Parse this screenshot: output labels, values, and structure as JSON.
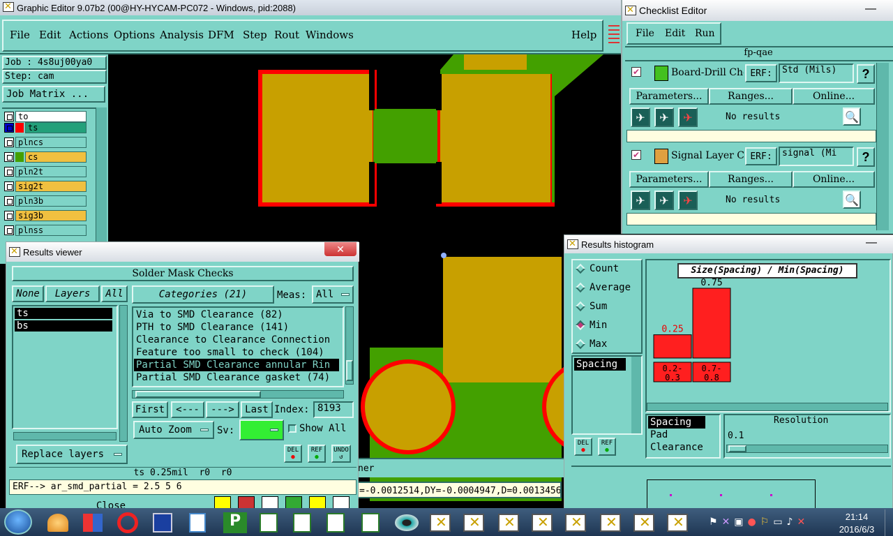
{
  "main_window": {
    "title": "Graphic Editor 9.07b2 (00@HY-HYCAM-PC072 - Windows, pid:2088)",
    "menu": [
      "File",
      "Edit",
      "Actions",
      "Options",
      "Analysis",
      "DFM",
      "Step",
      "Rout",
      "Windows"
    ],
    "help": "Help",
    "job": "Job : 4s8uj00ya0",
    "step": "Step: cam",
    "job_matrix": "Job Matrix ...",
    "layers": [
      {
        "name": "to",
        "color": "#ffffff"
      },
      {
        "name": "ts",
        "color": "#23a07a"
      },
      {
        "name": "plncs",
        "color": "#7fd4c7"
      },
      {
        "name": "cs",
        "color": "#f0c040"
      },
      {
        "name": "pln2t",
        "color": "#7fd4c7"
      },
      {
        "name": "sig2t",
        "color": "#f0c040"
      },
      {
        "name": "pln3b",
        "color": "#7fd4c7"
      },
      {
        "name": "sig3b",
        "color": "#f0c040"
      },
      {
        "name": "plnss",
        "color": "#7fd4c7"
      }
    ],
    "status_text": "ner",
    "coord_readout": "=-0.0012514,DY=-0.0004947,D=0.0013456"
  },
  "results_viewer": {
    "title": "Results viewer",
    "header": "Solder Mask Checks",
    "none_btn": "None",
    "layers_label": "Layers",
    "all_btn": "All",
    "layer_list": [
      "ts",
      "bs"
    ],
    "categories_label": "Categories (21)",
    "meas_label": "Meas:",
    "meas_value": "All",
    "categories": [
      "Via to SMD Clearance (82)",
      "PTH to SMD Clearance (141)",
      "Clearance to Clearance Connection",
      "Feature too small to check (104)",
      "Partial SMD Clearance annular Rin",
      "Partial SMD Clearance gasket (74)"
    ],
    "first": "First",
    "prev": "<---",
    "next": "--->",
    "last": "Last",
    "index_label": "Index:",
    "index_value": "8193",
    "auto_zoom": "Auto Zoom",
    "sv_label": "Sv:",
    "show_all": "Show All",
    "replace_layers": "Replace layers",
    "del": "DEL",
    "ref": "REF",
    "undo": "UNDO",
    "info_line": "ts 0.25mil  r0  r0",
    "erf_line": "ERF--> ar_smd_partial = 2.5 5 6",
    "close": "Close"
  },
  "checklist_editor": {
    "title": "Checklist Editor",
    "menu": [
      "File",
      "Edit",
      "Run"
    ],
    "checklist_name": "fp-qae",
    "items": [
      {
        "name": "Board-Drill Che",
        "erf_label": "ERF:",
        "erf_value": "Std (Mils)",
        "parameters": "Parameters...",
        "ranges": "Ranges...",
        "online": "Online...",
        "result": "No results"
      },
      {
        "name": "Signal Layer Ch",
        "erf_label": "ERF:",
        "erf_value": "signal (Mi",
        "parameters": "Parameters...",
        "ranges": "Ranges...",
        "online": "Online...",
        "result": "No results"
      }
    ],
    "help_glyph": "?"
  },
  "histogram": {
    "title": "Results histogram",
    "modes": [
      "Count",
      "Average",
      "Sum",
      "Min",
      "Max"
    ],
    "selected_mode": "Min",
    "left_list": [
      "Spacing"
    ],
    "chart_title": "Size(Spacing) / Min(Spacing)",
    "bar_color": "#ff1f1f",
    "del": "DEL",
    "ref": "REF",
    "bottom_list": [
      "Spacing",
      "Pad",
      "Clearance"
    ],
    "resolution_label": "Resolution",
    "resolution_value": "0.1"
  },
  "chart_data": {
    "type": "bar",
    "title": "Size(Spacing) / Min(Spacing)",
    "categories": [
      "0.2-0.3",
      "0.7-0.8"
    ],
    "values": [
      0.25,
      0.75
    ],
    "value_labels": [
      "0.25",
      "0.75"
    ],
    "ylim": [
      0,
      0.75
    ],
    "grid": false
  },
  "taskbar": {
    "time": "21:14",
    "date": "2016/6/3"
  }
}
